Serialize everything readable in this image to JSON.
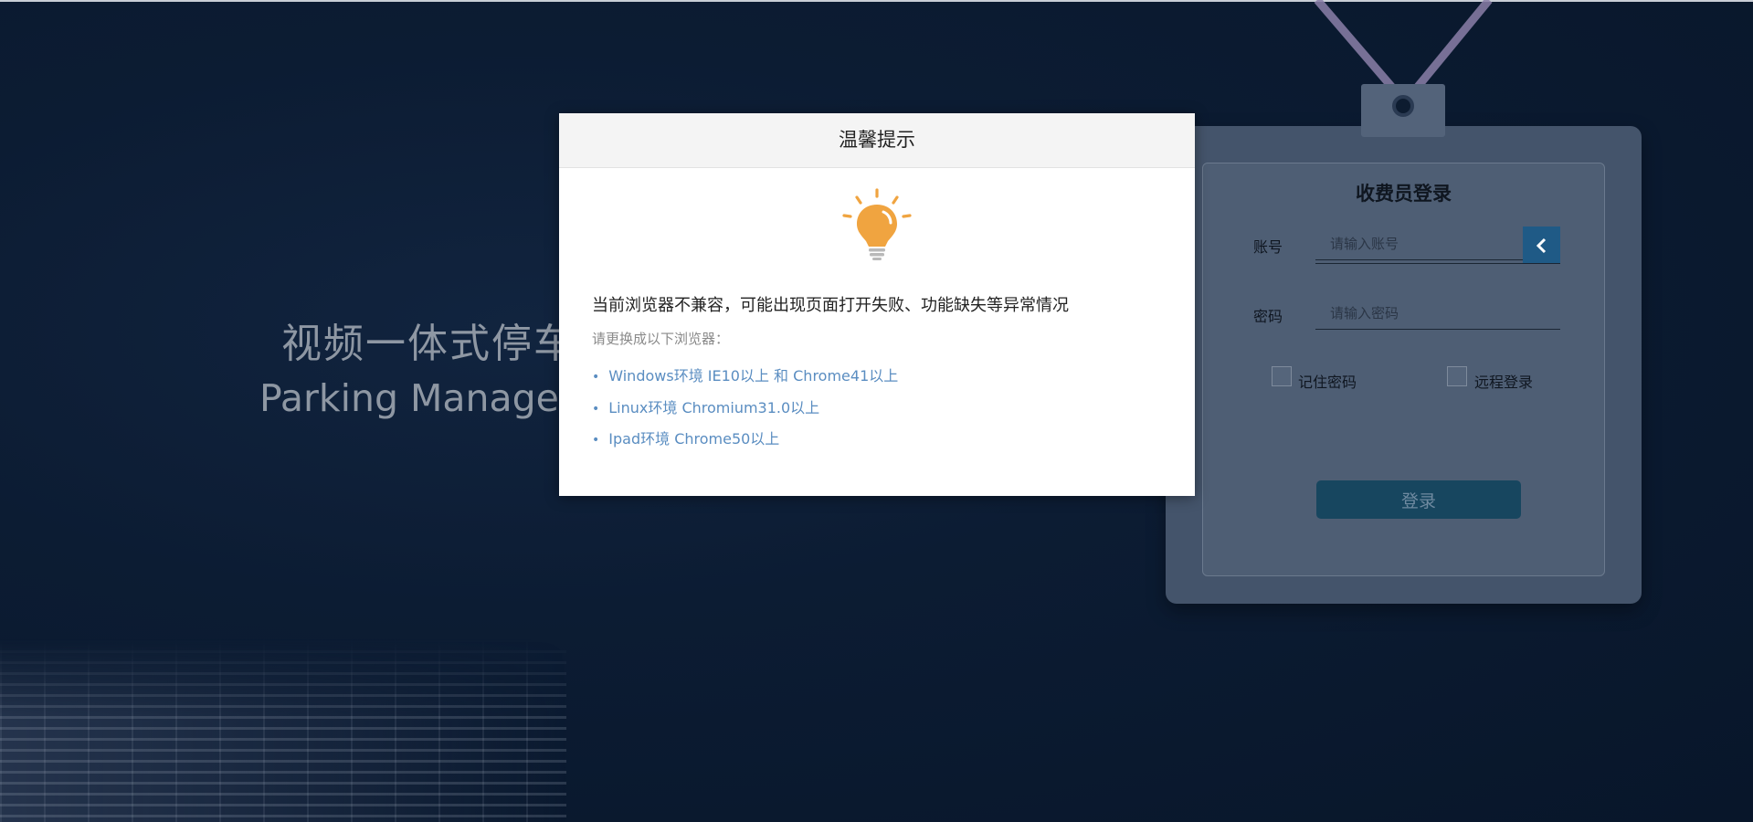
{
  "hero": {
    "title": "视频一体式停车",
    "subtitle": "Parking Manager"
  },
  "login": {
    "title": "收费员登录",
    "account_label": "账号",
    "account_placeholder": "请输入账号",
    "password_label": "密码",
    "password_placeholder": "请输入密码",
    "remember_label": "记住密码",
    "remote_label": "远程登录",
    "submit_label": "登录"
  },
  "modal": {
    "title": "温馨提示",
    "icon": "lightbulb-icon",
    "message": "当前浏览器不兼容，可能出现页面打开失败、功能缺失等异常情况",
    "hint": "请更换成以下浏览器：",
    "browsers": [
      "Windows环境 IE10以上 和 Chrome41以上",
      "Linux环境 Chromium31.0以上",
      "Ipad环境 Chrome50以上"
    ]
  },
  "colors": {
    "background": "#0b1a2e",
    "accent": "#1f5a86",
    "bulb": "#f0a440",
    "link": "#5a8dc1"
  }
}
